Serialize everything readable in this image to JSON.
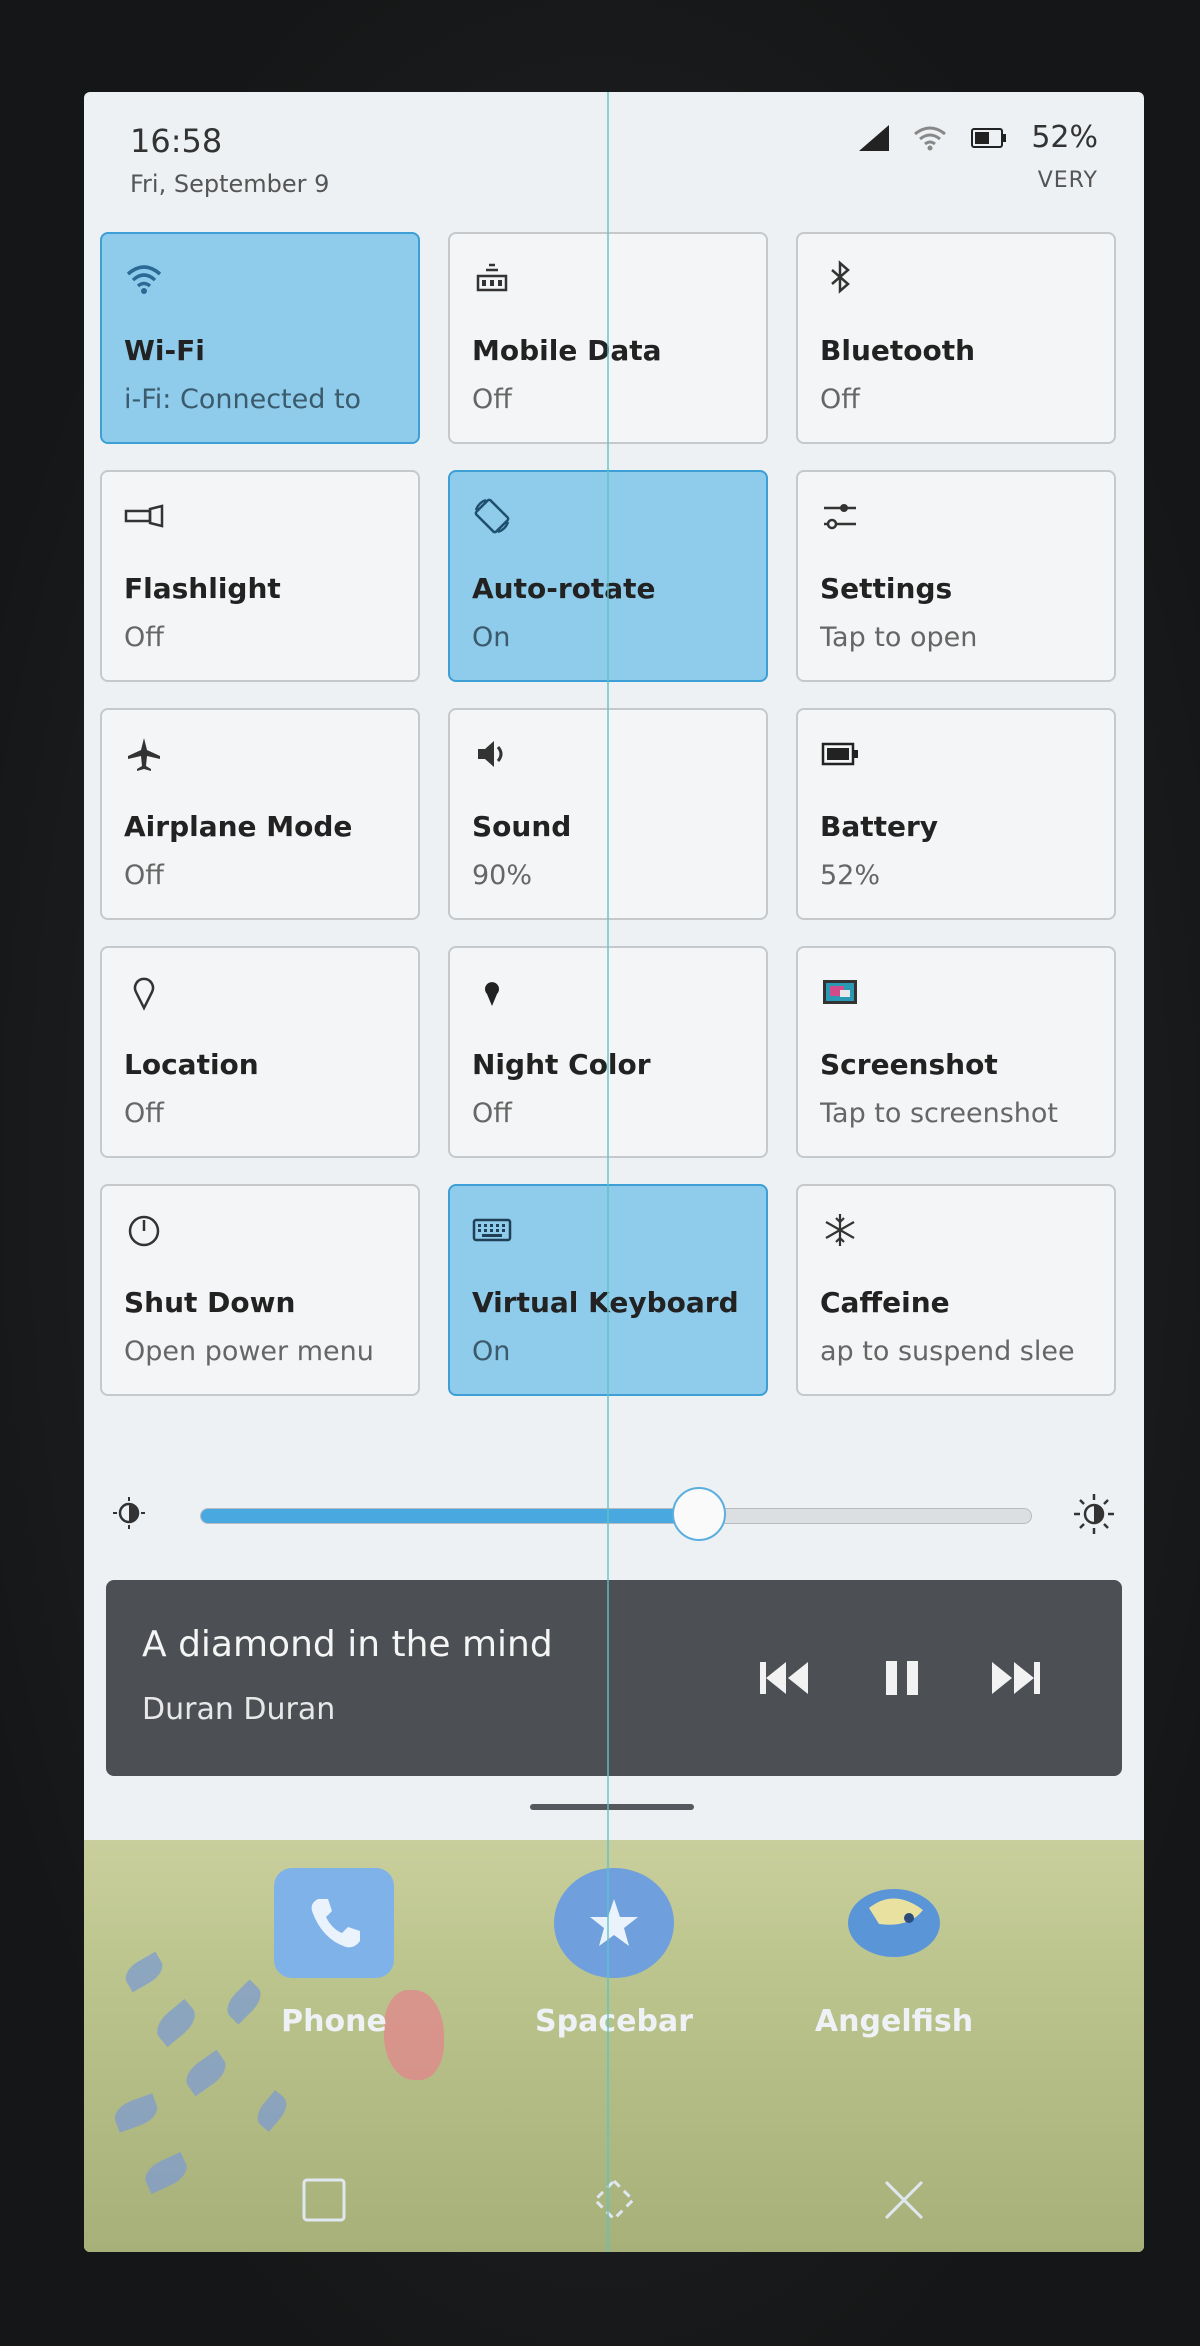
{
  "status_bar": {
    "time": "16:58",
    "date": "Fri, September 9",
    "battery_percent": "52%",
    "profile": "VERY"
  },
  "tiles": [
    {
      "title": "Wi-Fi",
      "subtitle": "i-Fi: Connected to",
      "icon": "wifi-icon",
      "on": true
    },
    {
      "title": "Mobile Data",
      "subtitle": "Off",
      "icon": "mobile-data-icon",
      "on": false
    },
    {
      "title": "Bluetooth",
      "subtitle": "Off",
      "icon": "bluetooth-icon",
      "on": false
    },
    {
      "title": "Flashlight",
      "subtitle": "Off",
      "icon": "flashlight-icon",
      "on": false
    },
    {
      "title": "Auto-rotate",
      "subtitle": "On",
      "icon": "auto-rotate-icon",
      "on": true
    },
    {
      "title": "Settings",
      "subtitle": "Tap to open",
      "icon": "settings-icon",
      "on": false
    },
    {
      "title": "Airplane Mode",
      "subtitle": "Off",
      "icon": "airplane-icon",
      "on": false
    },
    {
      "title": "Sound",
      "subtitle": "90%",
      "icon": "speaker-icon",
      "on": false
    },
    {
      "title": "Battery",
      "subtitle": "52%",
      "icon": "battery-icon",
      "on": false
    },
    {
      "title": "Location",
      "subtitle": "Off",
      "icon": "location-pin-icon",
      "on": false
    },
    {
      "title": "Night Color",
      "subtitle": "Off",
      "icon": "night-color-icon",
      "on": false
    },
    {
      "title": "Screenshot",
      "subtitle": "Tap to screenshot",
      "icon": "screenshot-icon",
      "on": false
    },
    {
      "title": "Shut Down",
      "subtitle": "Open power menu",
      "icon": "power-icon",
      "on": false
    },
    {
      "title": "Virtual Keyboard",
      "subtitle": "On",
      "icon": "keyboard-icon",
      "on": true
    },
    {
      "title": "Caffeine",
      "subtitle": "ap to suspend slee",
      "icon": "caffeine-icon",
      "on": false
    }
  ],
  "brightness": {
    "level": 0.6
  },
  "media": {
    "title": "A diamond in the mind",
    "artist": "Duran Duran"
  },
  "home_apps": [
    {
      "label": "Phone",
      "icon": "phone-icon"
    },
    {
      "label": "Spacebar",
      "icon": "spacebar-icon"
    },
    {
      "label": "Angelfish",
      "icon": "angelfish-icon"
    }
  ],
  "colors": {
    "tile_on": "#8fccec",
    "tile_on_border": "#3d9fd6",
    "accent": "#4aa8e0",
    "media_bg": "#4c5054"
  }
}
